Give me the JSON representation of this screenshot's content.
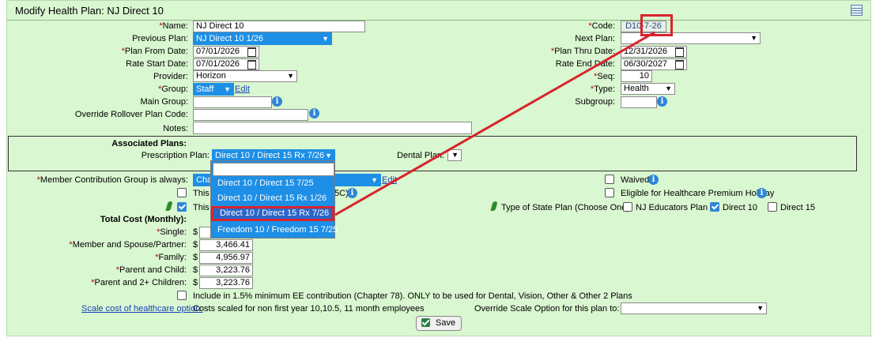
{
  "header": {
    "title": "Modify Health Plan: NJ Direct 10",
    "icon": "calendar-icon"
  },
  "form": {
    "name_label": "Name:",
    "name_value": "NJ Direct 10",
    "code_label": "Code:",
    "code_value": "D10-7-26",
    "previous_plan_label": "Previous Plan:",
    "previous_plan_value": "NJ Direct 10 1/26",
    "next_plan_label": "Next Plan:",
    "next_plan_value": "",
    "plan_from_label": "Plan From Date:",
    "plan_from_value": "07/01/2026",
    "plan_thru_label": "Plan Thru Date:",
    "plan_thru_value": "12/31/2026",
    "rate_start_label": "Rate Start Date:",
    "rate_start_value": "07/01/2026",
    "rate_end_label": "Rate End Date:",
    "rate_end_value": "06/30/2027",
    "provider_label": "Provider:",
    "provider_value": "Horizon",
    "seq_label": "Seq:",
    "seq_value": "10",
    "group_label": "Group:",
    "group_value": "Staff",
    "group_edit": "Edit",
    "type_label": "Type:",
    "type_value": "Health",
    "main_group_label": "Main Group:",
    "subgroup_label": "Subgroup:",
    "override_rollover_label": "Override Rollover Plan Code:",
    "notes_label": "Notes:"
  },
  "associated": {
    "heading": "Associated Plans:",
    "prescription_label": "Prescription Plan:",
    "prescription_value": "Direct 10 / Direct 15 Rx 7/26",
    "dental_label": "Dental Plan:",
    "dropdown_options": [
      "",
      "Direct 10 / Direct 15 7/25",
      "Direct 10 / Direct 15 Rx 1/26",
      "Direct 10 / Direct 15 Rx 7/26",
      "Freedom 10 / Freedom 15 7/25"
    ]
  },
  "contribution": {
    "member_group_label": "Member Contribution Group is always:",
    "member_group_value": "Chap",
    "member_group_edit": "Edit",
    "this_is_partial": "This i",
    "this_is_tail": "5C)",
    "this_partial2": "This",
    "waived_label": "Waived",
    "eligible_label": "Eligible for Healthcare Premium Holiday",
    "state_plan_label": "Type of State Plan (Choose One):",
    "state_plan_options": [
      "NJ Educators Plan",
      "Direct 10",
      "Direct 15"
    ]
  },
  "costs": {
    "heading": "Total Cost (Monthly):",
    "currency": "$",
    "single_label": "Single:",
    "single_value": "",
    "spouse_label": "Member and Spouse/Partner:",
    "spouse_value": "3,466.41",
    "family_label": "Family:",
    "family_value": "4,956.97",
    "parent_child_label": "Parent and Child:",
    "parent_child_value": "3,223.76",
    "parent_2plus_label": "Parent and 2+ Children:",
    "parent_2plus_value": "3,223.76"
  },
  "footer": {
    "include_label": "Include in 1.5% minimum EE contribution (Chapter 78). ONLY to be used for Dental, Vision, Other & Other 2 Plans",
    "scale_link": "Scale cost of healthcare option:",
    "scale_text": "Costs scaled for non first year 10,10.5, 11 month employees",
    "override_scale_label": "Override Scale Option for this plan to:",
    "save_label": "Save"
  },
  "colors": {
    "panel": "#d9f7d0",
    "accent": "#1e8fe6",
    "required": "#c00000",
    "annotation": "#d9232e"
  }
}
